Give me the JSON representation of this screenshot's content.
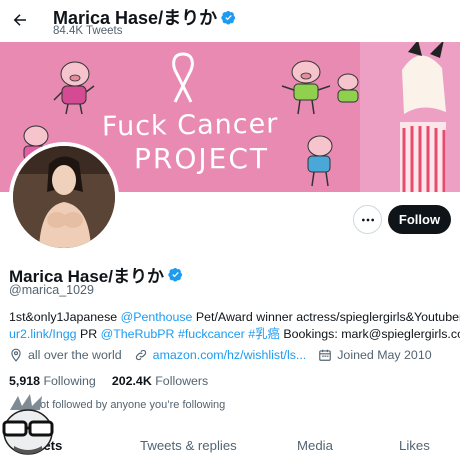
{
  "header": {
    "title": "Marica Hase/まりか",
    "tweet_count": "84.4K Tweets"
  },
  "banner": {
    "line1": "Fuck Cancer",
    "line2": "PROJECT",
    "color": "#e98ab3"
  },
  "actions": {
    "more_icon": "ellipsis-icon",
    "follow_label": "Follow"
  },
  "profile": {
    "name": "Marica Hase/まりか",
    "handle": "@marica_1029",
    "bio_line1_pre": "1st&only1Japanese ",
    "bio_line1_link": "@Penthouse",
    "bio_line1_post": " Pet/Award winner actress/spieglergirls&Youtuber",
    "bio_line2_link1": "ur2.link/Ingg",
    "bio_line2_mid1": " PR ",
    "bio_line2_link2": "@TheRubPR",
    "bio_line2_sp1": " ",
    "bio_line2_link3": "#fuckcancer",
    "bio_line2_sp2": " ",
    "bio_line2_link4": "#乳癌",
    "bio_line2_post": " Bookings: mark@spieglergirls.com",
    "location": "all over the world",
    "website": "amazon.com/hz/wishlist/ls...",
    "joined": "Joined May 2010",
    "following_count": "5,918",
    "following_label": "Following",
    "followers_count": "202.4K",
    "followers_label": "Followers",
    "followed_by": "Not followed by anyone you're following",
    "followed_by_visible": "ot followed by anyone you’re following"
  },
  "tabs": [
    {
      "label": "Tweets",
      "visible": "eets",
      "active": true
    },
    {
      "label": "Tweets & replies",
      "active": false
    },
    {
      "label": "Media",
      "active": false
    },
    {
      "label": "Likes",
      "active": false
    }
  ],
  "colors": {
    "accent": "#1d9bf0",
    "text": "#0f1419",
    "muted": "#536471",
    "follow_bg": "#0f1419"
  }
}
